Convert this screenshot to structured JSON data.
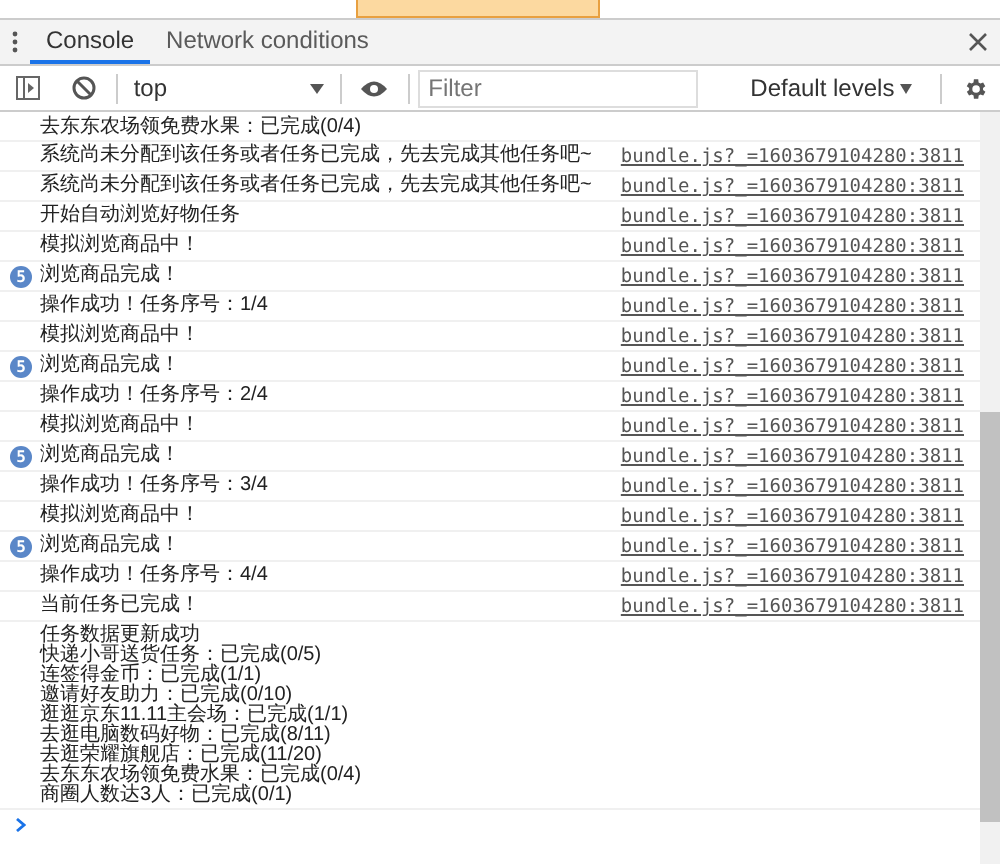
{
  "tabs": [
    {
      "label": "Console",
      "selected": true
    },
    {
      "label": "Network conditions",
      "selected": false
    }
  ],
  "toolbar": {
    "context": "top",
    "filter_placeholder": "Filter",
    "levels": "Default levels"
  },
  "messages": [
    {
      "kind": "log",
      "lines": [
        "去东东农场领免费水果：已完成(0/4)"
      ]
    },
    {
      "kind": "log",
      "lines": [
        "系统尚未分配到该任务或者任务已完成，先去完成其他任务吧~"
      ],
      "source": "bundle.js?_=1603679104280:3811"
    },
    {
      "kind": "log",
      "lines": [
        "系统尚未分配到该任务或者任务已完成，先去完成其他任务吧~"
      ],
      "source": "bundle.js?_=1603679104280:3811"
    },
    {
      "kind": "log",
      "lines": [
        "开始自动浏览好物任务"
      ],
      "source": "bundle.js?_=1603679104280:3811"
    },
    {
      "kind": "log",
      "lines": [
        "模拟浏览商品中！"
      ],
      "source": "bundle.js?_=1603679104280:3811"
    },
    {
      "kind": "repeat",
      "count": "5",
      "lines": [
        "浏览商品完成！"
      ],
      "source": "bundle.js?_=1603679104280:3811"
    },
    {
      "kind": "log",
      "lines": [
        "操作成功！任务序号：1/4"
      ],
      "source": "bundle.js?_=1603679104280:3811"
    },
    {
      "kind": "log",
      "lines": [
        "模拟浏览商品中！"
      ],
      "source": "bundle.js?_=1603679104280:3811"
    },
    {
      "kind": "repeat",
      "count": "5",
      "lines": [
        "浏览商品完成！"
      ],
      "source": "bundle.js?_=1603679104280:3811"
    },
    {
      "kind": "log",
      "lines": [
        "操作成功！任务序号：2/4"
      ],
      "source": "bundle.js?_=1603679104280:3811"
    },
    {
      "kind": "log",
      "lines": [
        "模拟浏览商品中！"
      ],
      "source": "bundle.js?_=1603679104280:3811"
    },
    {
      "kind": "repeat",
      "count": "5",
      "lines": [
        "浏览商品完成！"
      ],
      "source": "bundle.js?_=1603679104280:3811"
    },
    {
      "kind": "log",
      "lines": [
        "操作成功！任务序号：3/4"
      ],
      "source": "bundle.js?_=1603679104280:3811"
    },
    {
      "kind": "log",
      "lines": [
        "模拟浏览商品中！"
      ],
      "source": "bundle.js?_=1603679104280:3811"
    },
    {
      "kind": "repeat",
      "count": "5",
      "lines": [
        "浏览商品完成！"
      ],
      "source": "bundle.js?_=1603679104280:3811"
    },
    {
      "kind": "log",
      "lines": [
        "操作成功！任务序号：4/4"
      ],
      "source": "bundle.js?_=1603679104280:3811"
    },
    {
      "kind": "log",
      "lines": [
        "当前任务已完成！"
      ],
      "source": "bundle.js?_=1603679104280:3811"
    },
    {
      "kind": "log",
      "lines": [
        "任务数据更新成功",
        "快递小哥送货任务：已完成(0/5)",
        "连签得金币：已完成(1/1)",
        "邀请好友助力：已完成(0/10)",
        "逛逛京东11.11主会场：已完成(1/1)",
        "去逛电脑数码好物：已完成(8/11)",
        "去逛荣耀旗舰店：已完成(11/20)",
        "去东东农场领免费水果：已完成(0/4)",
        "商圈人数达3人：已完成(0/1)"
      ]
    }
  ]
}
